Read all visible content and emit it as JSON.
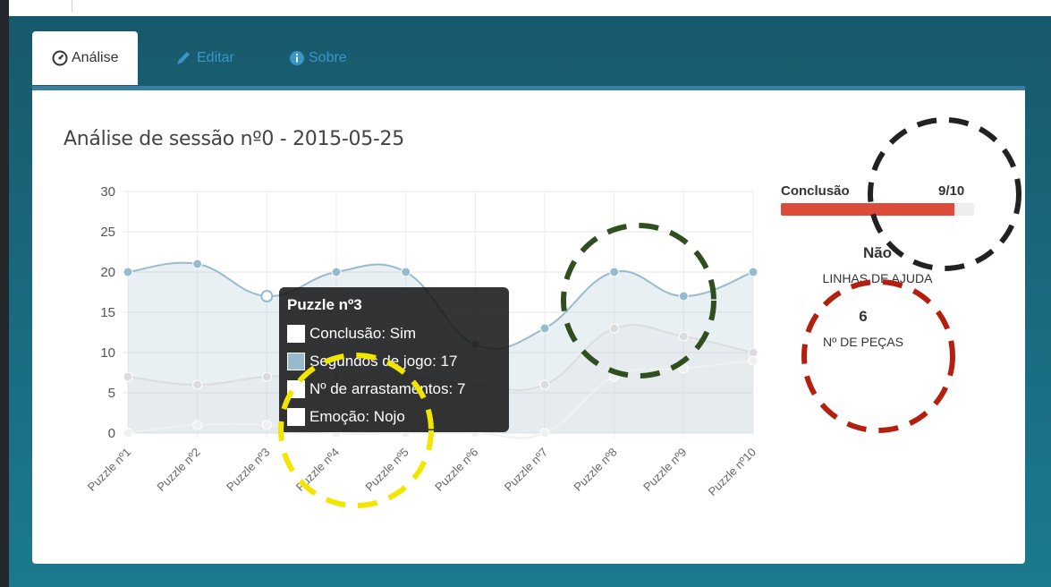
{
  "tabs": [
    {
      "label": "Análise",
      "icon": "dashboard-icon"
    },
    {
      "label": "Editar",
      "icon": "pencil-icon"
    },
    {
      "label": "Sobre",
      "icon": "info-circle-icon"
    }
  ],
  "session": {
    "title": "Análise de sessão nº0 - 2015-05-25"
  },
  "chart_data": {
    "type": "line",
    "categories": [
      "Puzzle nº1",
      "Puzzle nº2",
      "Puzzle nº3",
      "Puzzle nº4",
      "Puzzle nº5",
      "Puzzle nº6",
      "Puzzle nº7",
      "Puzzle nº8",
      "Puzzle nº9",
      "Puzzle nº10"
    ],
    "ylim": [
      0,
      30
    ],
    "yticks": [
      0,
      5,
      10,
      15,
      20,
      25,
      30
    ],
    "grid": true,
    "series": [
      {
        "values": [
          20,
          21,
          17,
          20,
          20,
          11,
          13,
          20,
          17,
          20
        ],
        "color": "#97bbcd",
        "fill": "rgba(151,187,205,0.22)"
      },
      {
        "values": [
          7,
          6,
          7,
          7,
          7,
          6,
          6,
          13,
          12,
          10
        ],
        "color": "#dcdcdc",
        "fill": "rgba(220,220,220,0.22)"
      },
      {
        "values": [
          0,
          1,
          1,
          0,
          0,
          0,
          0,
          7,
          8,
          9
        ],
        "color": "#f0f0f0",
        "fill": "rgba(240,240,240,0.1)"
      }
    ]
  },
  "tooltip": {
    "title": "Puzzle nº3",
    "rows": [
      {
        "text": "Conclusão: Sim",
        "color": "#ffffff"
      },
      {
        "text": "Segundos de jogo: 17",
        "color": "#97bbcd"
      },
      {
        "text": "Nº de arrastamentos: 7",
        "color": "#ffffff"
      },
      {
        "text": "Emoção: Nojo",
        "color": "#ffffff"
      }
    ]
  },
  "stats": {
    "conclusion_label": "Conclusão",
    "conclusion_value": "9/10",
    "conclusion_fraction": 0.9,
    "help_lines_value": "Não",
    "help_lines_label": "LINHAS DE AJUDA",
    "pieces_value": "6",
    "pieces_label": "Nº DE PEÇAS"
  },
  "colors": {
    "progress": "#dd4b3a",
    "circle_black": "#222222",
    "circle_green": "#2f4f1e",
    "circle_red": "#b3200f",
    "circle_yellow": "#f2e600"
  }
}
